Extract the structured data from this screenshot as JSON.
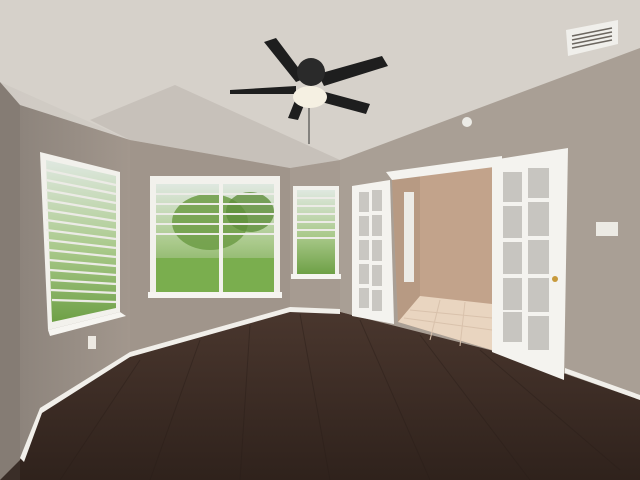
{
  "scene": {
    "description_visible_text": "",
    "palette": {
      "ceiling": "#d9d4cd",
      "ceiling_shadow": "#b9b3ab",
      "wall": "#9e938a",
      "wall_light": "#b3a89e",
      "floor_dark": "#3a2a22",
      "floor_mid": "#4a372d",
      "trim": "#f3f1ec",
      "door_frame": "#f4f3ef",
      "glass": "#c9c7c2",
      "tile": "#e9d6c2",
      "hall_wall": "#c4a58d",
      "window_green": "#7fb05a",
      "fan_dark": "#1f1f1f",
      "fan_light": "#f6f2e6"
    }
  }
}
